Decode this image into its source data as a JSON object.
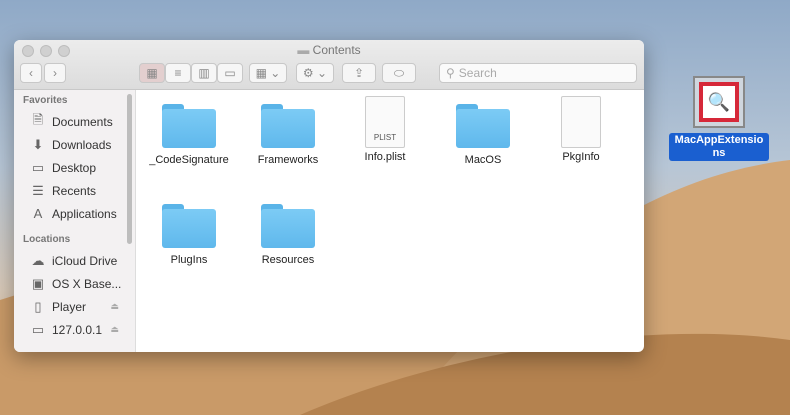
{
  "window": {
    "title": "Contents"
  },
  "toolbar": {
    "search_placeholder": "Search"
  },
  "sidebar": {
    "favorites_header": "Favorites",
    "favorites": [
      {
        "label": "Documents",
        "icon": "documents-icon"
      },
      {
        "label": "Downloads",
        "icon": "downloads-icon"
      },
      {
        "label": "Desktop",
        "icon": "desktop-icon"
      },
      {
        "label": "Recents",
        "icon": "recents-icon"
      },
      {
        "label": "Applications",
        "icon": "applications-icon"
      }
    ],
    "locations_header": "Locations",
    "locations": [
      {
        "label": "iCloud Drive"
      },
      {
        "label": "OS X Base..."
      },
      {
        "label": "Player"
      },
      {
        "label": "127.0.0.1"
      }
    ]
  },
  "files": [
    {
      "label": "_CodeSignature",
      "type": "folder"
    },
    {
      "label": "Frameworks",
      "type": "folder"
    },
    {
      "label": "Info.plist",
      "type": "file",
      "badge": "PLIST"
    },
    {
      "label": "MacOS",
      "type": "folder"
    },
    {
      "label": "PkgInfo",
      "type": "file"
    },
    {
      "label": "PlugIns",
      "type": "folder"
    },
    {
      "label": "Resources",
      "type": "folder"
    }
  ],
  "desktop": {
    "item_label": "MacAppExtensions"
  }
}
